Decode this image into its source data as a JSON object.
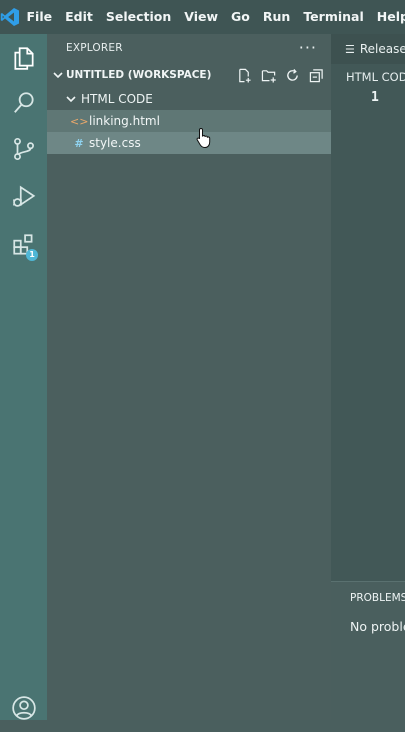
{
  "menubar": {
    "items": [
      "File",
      "Edit",
      "Selection",
      "View",
      "Go",
      "Run",
      "Terminal",
      "Help"
    ]
  },
  "activity": {
    "icons": [
      "explorer-icon",
      "search-icon",
      "source-control-icon",
      "run-debug-icon",
      "extensions-icon",
      "account-icon"
    ],
    "extensions_badge": "1"
  },
  "explorer": {
    "title": "EXPLORER",
    "more": "···",
    "workspace": "UNTITLED (WORKSPACE)",
    "folder": "HTML CODE",
    "files": [
      {
        "name": "linking.html",
        "icon": "<>"
      },
      {
        "name": "style.css",
        "icon": "#"
      }
    ]
  },
  "editor": {
    "tab_label": "Release",
    "breadcrumb": "HTML CODE",
    "line_number": "1"
  },
  "panel": {
    "tab": "PROBLEMS",
    "message": "No proble"
  },
  "colors": {
    "activity_bar": "#4a7472",
    "sidebar": "#4b5f5e",
    "titlebar": "#3f5554",
    "badge": "#4fb7d6",
    "vscode_blue": "#2f9ee8"
  }
}
